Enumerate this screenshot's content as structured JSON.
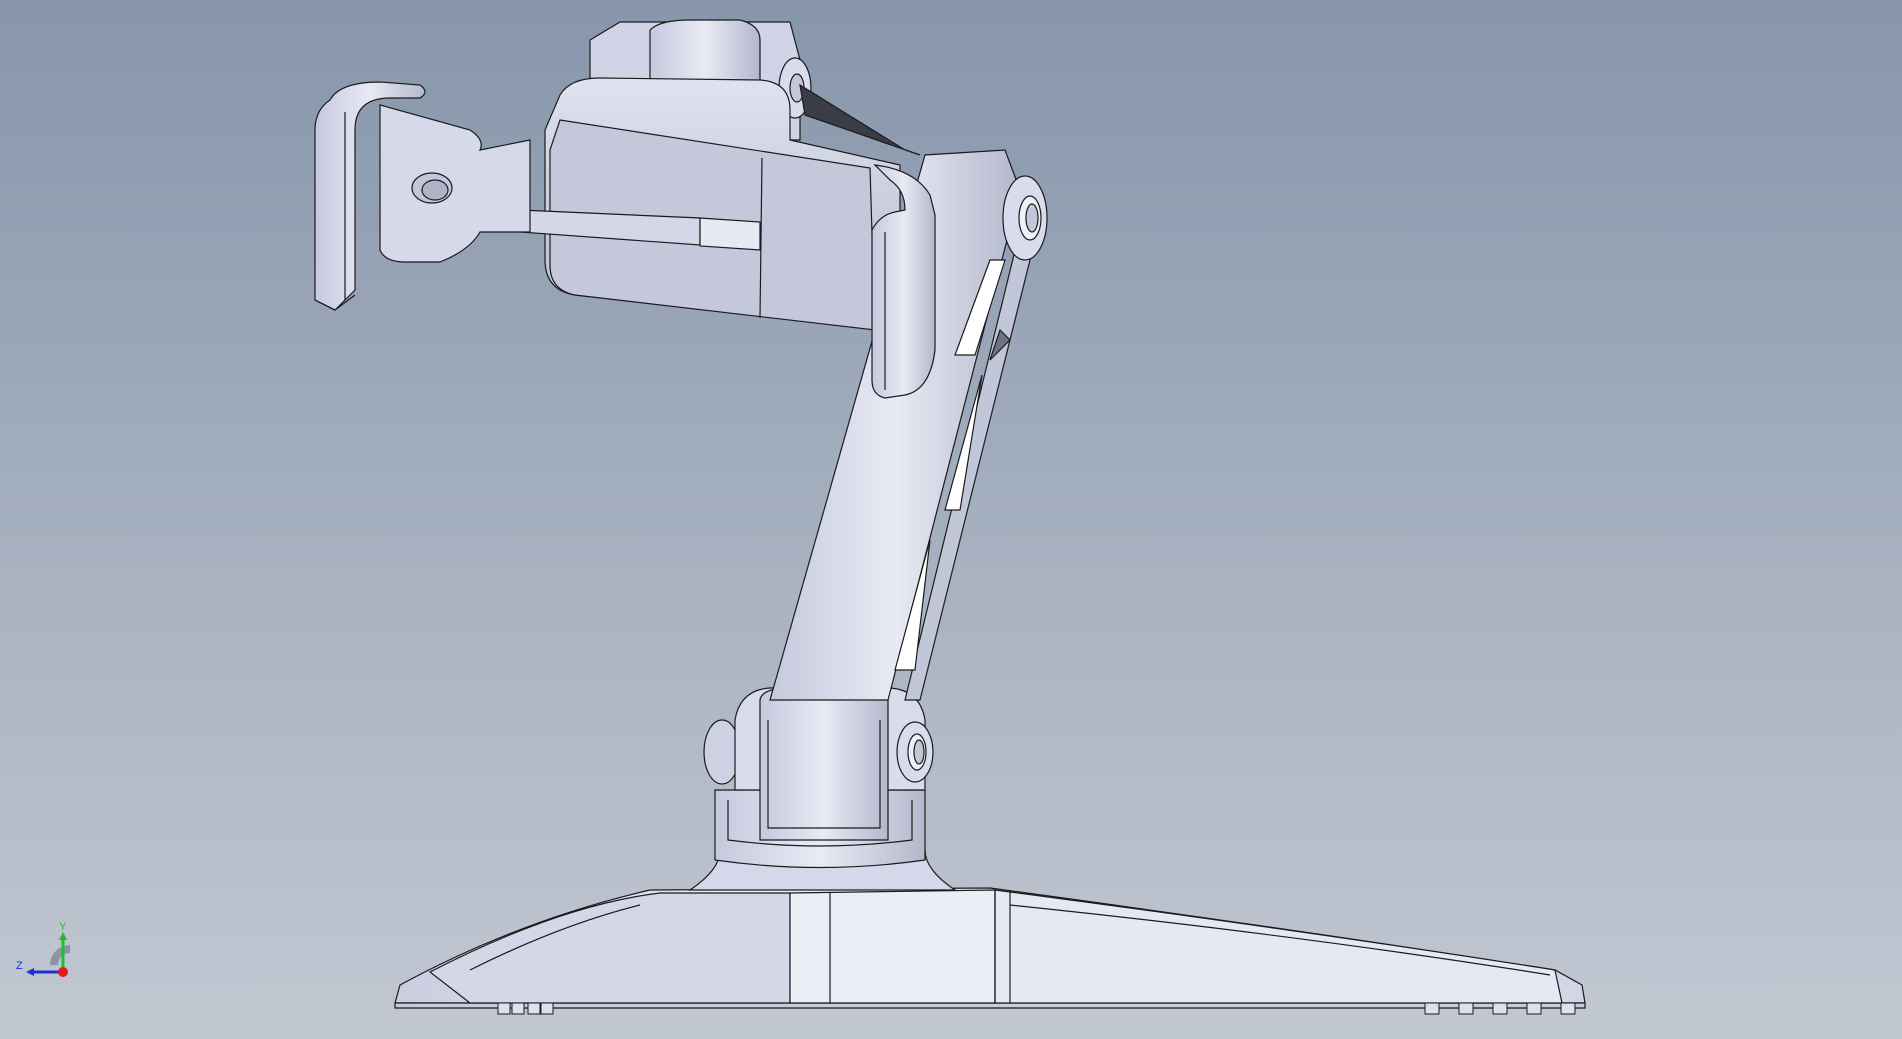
{
  "viewport": {
    "background_top": "#8796ab",
    "background_bottom": "#c2c8d2"
  },
  "model": {
    "part_color": "#d6d9ea",
    "part_shade": "#b8bccf",
    "part_dark": "#8d92a8",
    "edge_color": "#1b1b1b"
  },
  "triad": {
    "y_label": "Y",
    "z_label": "Z",
    "x_color": "#e31b1b",
    "y_color": "#1fbf2b",
    "z_color": "#1a2fd6"
  }
}
